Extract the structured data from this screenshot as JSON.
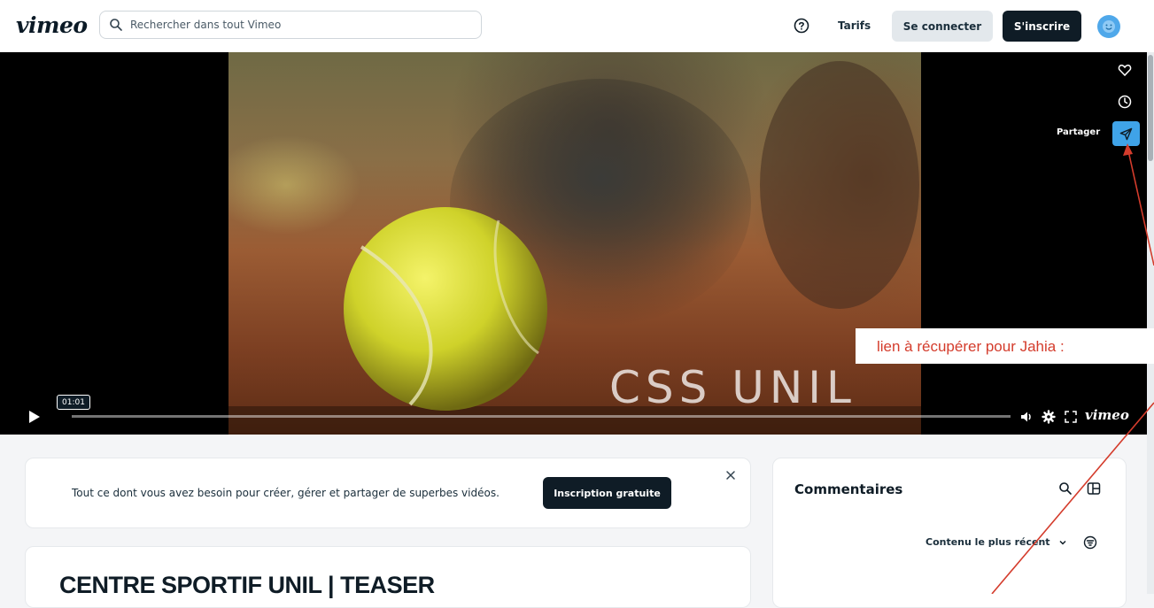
{
  "header": {
    "logo": "vimeo",
    "search_placeholder": "Rechercher dans tout Vimeo",
    "pricing": "Tarifs",
    "login": "Se connecter",
    "signup": "S'inscrire",
    "icons": [
      "search-icon",
      "help-icon",
      "avatar"
    ]
  },
  "player": {
    "overlay_title": "CSS UNIL",
    "share_label": "Partager",
    "timestamp": "01:01",
    "logo": "vimeo",
    "icons": [
      "heart-icon",
      "clock-icon",
      "send-icon",
      "play-icon",
      "volume-icon",
      "settings-icon",
      "fullscreen-icon"
    ],
    "progress_fraction": 0.0
  },
  "promo": {
    "text": "Tout ce dont vous avez besoin pour créer, gérer et partager de superbes vidéos.",
    "button": "Inscription gratuite"
  },
  "video": {
    "title": "CENTRE SPORTIF UNIL | TEASER"
  },
  "comments": {
    "title": "Commentaires",
    "sort": "Contenu le plus récent"
  },
  "annotation": {
    "text": "lien à récupérer pour Jahia :",
    "color": "#d43c2c"
  },
  "colors": {
    "accent": "#3fa3e8",
    "dark": "#0f1c26"
  }
}
